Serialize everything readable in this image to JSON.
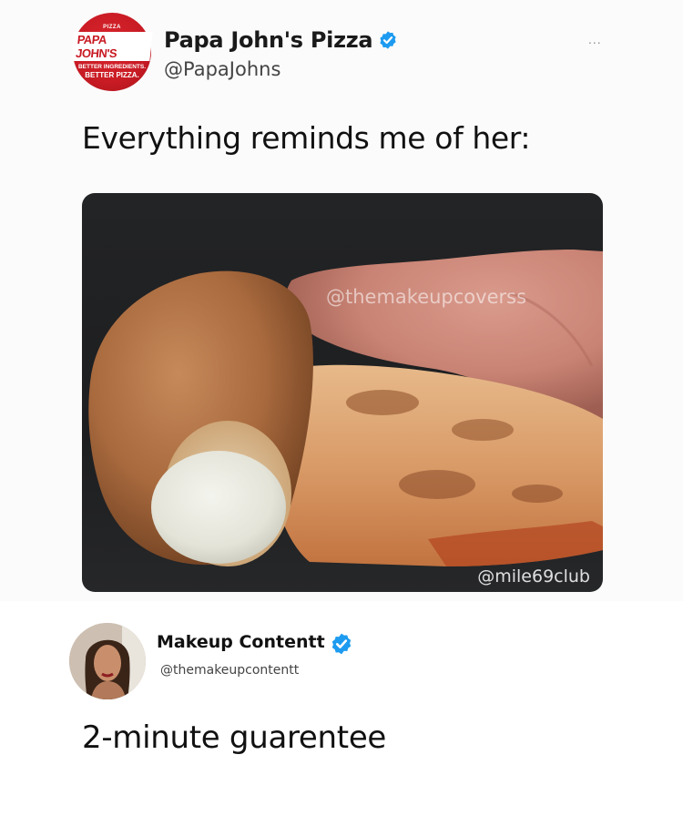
{
  "tweet": {
    "author_name": "Papa John's Pizza",
    "author_handle": "@PapaJohns",
    "more_label": "...",
    "text": "Everything reminds me of her:",
    "logo": {
      "top": "PIZZA",
      "brand": "PAPA JOHN'S",
      "tagline_1": "BETTER INGREDIENTS.",
      "tagline_2": "BETTER PIZZA."
    },
    "image": {
      "watermark_center": "@themakeupcoverss",
      "watermark_corner": "@mile69club"
    }
  },
  "reply": {
    "author_name": "Makeup Contentt",
    "author_handle": "@themakeupcontentt",
    "text": "2-minute guarentee"
  },
  "colors": {
    "verified_blue": "#1d9bf0",
    "brand_red": "#c81b24"
  },
  "icons": [
    "verified-badge-icon",
    "more-options-icon"
  ]
}
